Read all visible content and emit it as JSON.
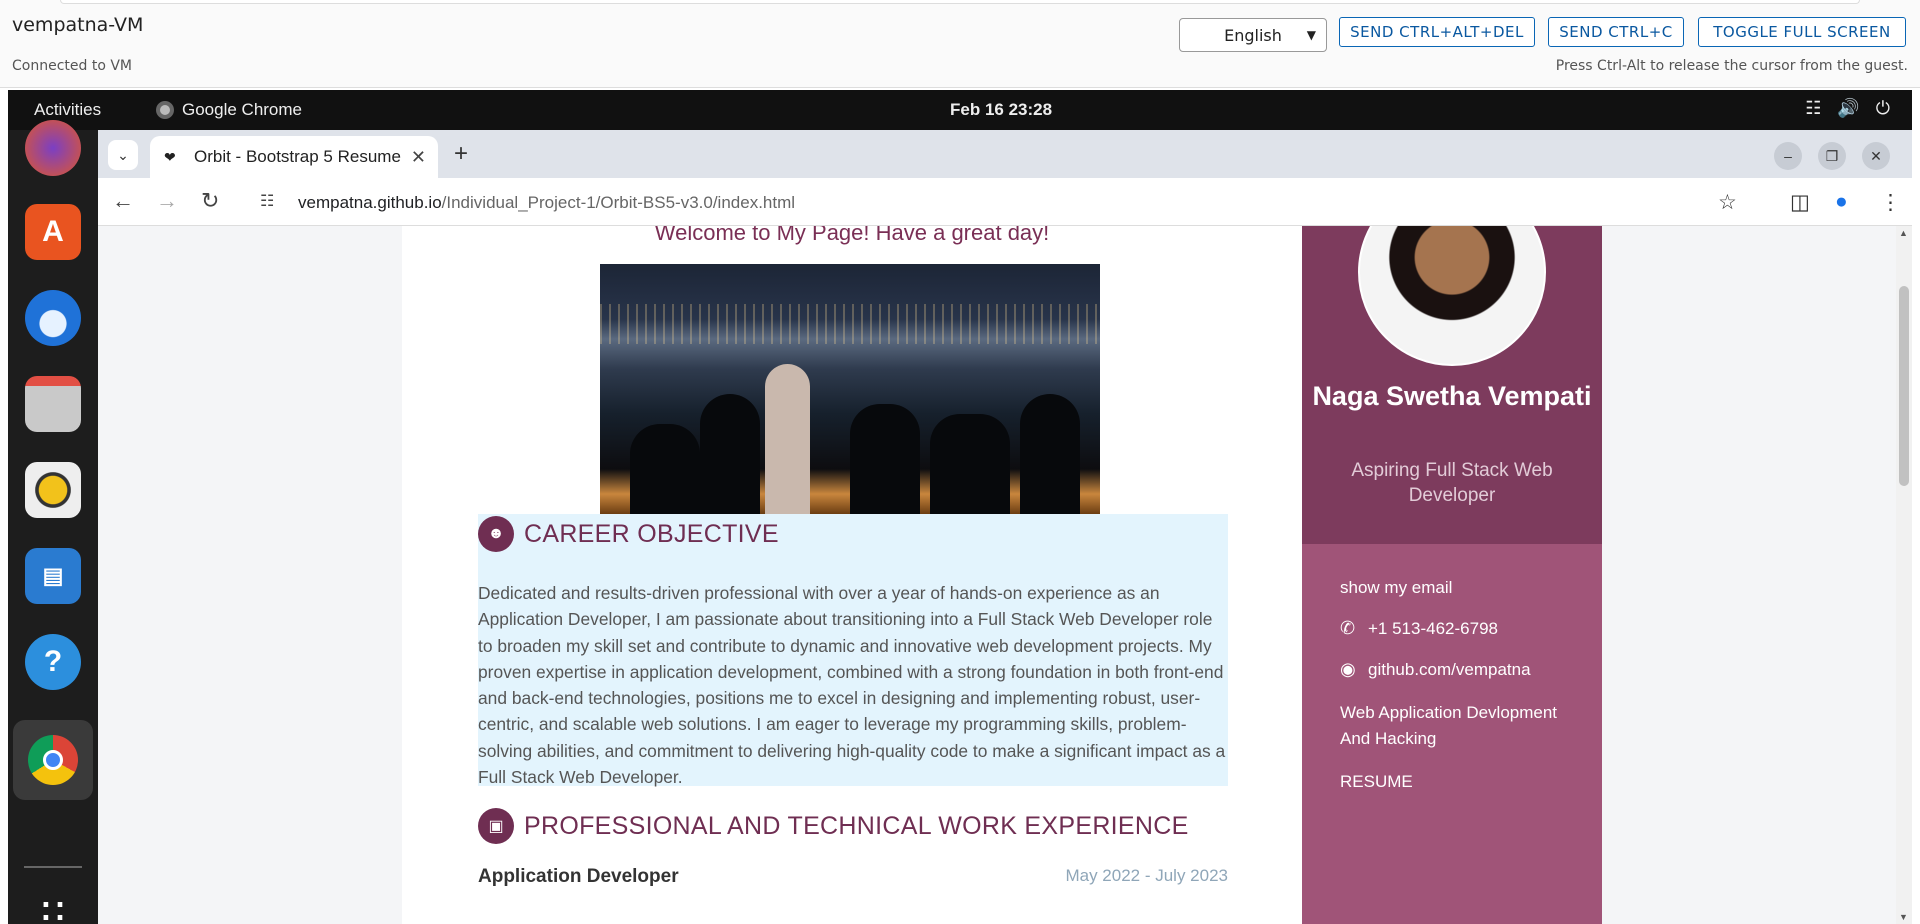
{
  "vm": {
    "title": "vempatna-VM",
    "status": "Connected to VM",
    "language": "English",
    "buttons": [
      "SEND CTRL+ALT+DEL",
      "SEND CTRL+C",
      "TOGGLE FULL SCREEN"
    ],
    "hint": "Press Ctrl-Alt to release the cursor from the guest."
  },
  "topbar": {
    "activities": "Activities",
    "app": "Google Chrome",
    "clock": "Feb 16  23:28"
  },
  "dock": {
    "icons": [
      "firefox-icon",
      "app-center-icon",
      "thunderbird-icon",
      "files-icon",
      "rhythmbox-icon",
      "writer-icon",
      "help-icon",
      "chrome-icon",
      "show-apps-icon"
    ]
  },
  "browser": {
    "tab_title": "Orbit - Bootstrap 5 Resume",
    "url_host": "vempatna.github.io",
    "url_path": "/Individual_Project-1/Orbit-BS5-v3.0/index.html"
  },
  "page": {
    "welcome": "Welcome to My Page! Have a great day!",
    "objective": {
      "heading": "CAREER OBJECTIVE",
      "text": "Dedicated and results-driven professional with over a year of hands-on experience as an Application Developer, I am passionate about transitioning into a Full Stack Web Developer role to broaden my skill set and contribute to dynamic and innovative web development projects. My proven expertise in application development, combined with a strong foundation in both front-end and back-end technologies, positions me to excel in designing and implementing robust, user-centric, and scalable web solutions. I am eager to leverage my programming skills, problem-solving abilities, and commitment to delivering high-quality code to make a significant impact as a Full Stack Web Developer."
    },
    "work": {
      "heading": "PROFESSIONAL AND TECHNICAL WORK EXPERIENCE",
      "job_title": "Application Developer",
      "job_dates": "May 2022 - July 2023"
    },
    "sidebar": {
      "name": "Naga Swetha Vempati",
      "role": "Aspiring Full Stack Web Developer",
      "email": "show my email",
      "phone": "+1 513-462-6798",
      "github": "github.com/vempatna",
      "interest": "Web Application Devlopment And Hacking",
      "resume": "RESUME"
    }
  }
}
